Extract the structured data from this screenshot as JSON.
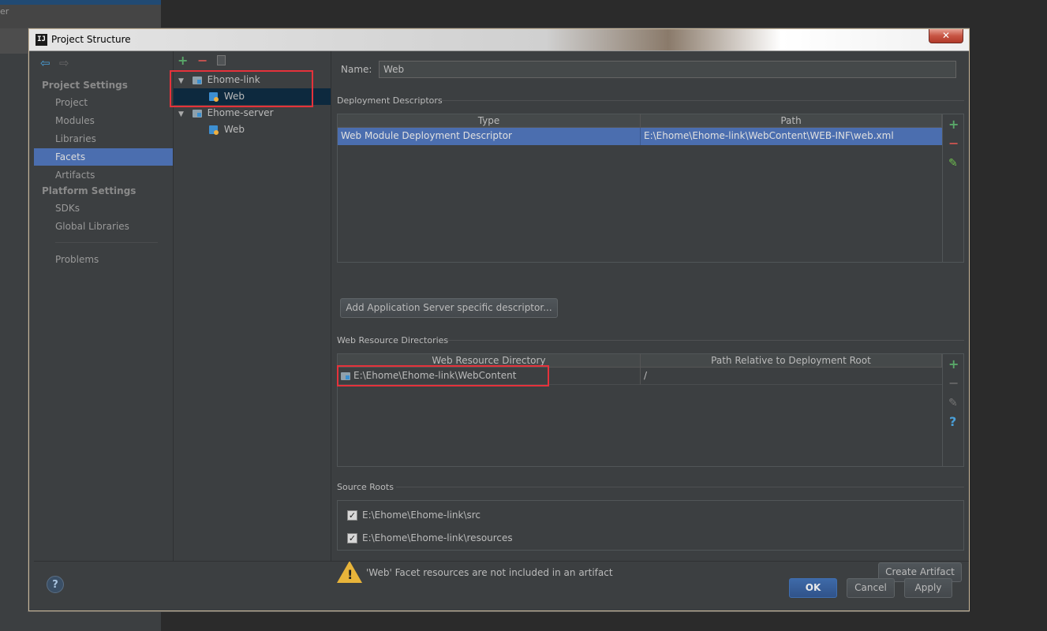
{
  "background": {
    "left_panel_text": "er"
  },
  "window": {
    "icon_text": "IJ",
    "title": "Project Structure",
    "close_glyph": "✕"
  },
  "nav": {
    "back_glyph": "⇦",
    "forward_glyph": "⇨",
    "project_settings_heading": "Project Settings",
    "project_items": [
      "Project",
      "Modules",
      "Libraries",
      "Facets",
      "Artifacts"
    ],
    "platform_settings_heading": "Platform Settings",
    "platform_items": [
      "SDKs",
      "Global Libraries"
    ],
    "problems": "Problems",
    "selected": "Facets"
  },
  "tree": {
    "add_glyph": "+",
    "remove_glyph": "−",
    "nodes": [
      {
        "label": "Ehome-link",
        "expanded_glyph": "▼",
        "children": [
          {
            "label": "Web",
            "selected": true
          }
        ]
      },
      {
        "label": "Ehome-server",
        "expanded_glyph": "▼",
        "children": [
          {
            "label": "Web",
            "selected": false
          }
        ]
      }
    ]
  },
  "facet": {
    "name_label": "Name:",
    "name_value": "Web",
    "deployment": {
      "section_label": "Deployment Descriptors",
      "columns": [
        "Type",
        "Path"
      ],
      "rows": [
        {
          "type": "Web Module Deployment Descriptor",
          "path": "E:\\Ehome\\Ehome-link\\WebContent\\WEB-INF\\web.xml",
          "selected": true
        }
      ],
      "add_button": "Add Application Server specific descriptor..."
    },
    "resources": {
      "section_label": "Web Resource Directories",
      "columns": [
        "Web Resource Directory",
        "Path Relative to Deployment Root"
      ],
      "rows": [
        {
          "directory": "E:\\Ehome\\Ehome-link\\WebContent",
          "relative": "/"
        }
      ]
    },
    "source_roots": {
      "section_label": "Source Roots",
      "items": [
        {
          "path": "E:\\Ehome\\Ehome-link\\src",
          "checked": true
        },
        {
          "path": "E:\\Ehome\\Ehome-link\\resources",
          "checked": true
        }
      ]
    },
    "warning": {
      "text": "'Web' Facet resources are not included in an artifact",
      "button": "Create Artifact"
    },
    "tool_glyphs": {
      "add": "+",
      "remove": "−",
      "edit": "✎",
      "help": "?"
    }
  },
  "footer": {
    "help_glyph": "?",
    "ok": "OK",
    "cancel": "Cancel",
    "apply": "Apply"
  },
  "colors": {
    "accent_selection": "#4b6eaf",
    "add_green": "#59a869",
    "remove_red": "#c75450",
    "highlight_box": "#e5323b",
    "warning_yellow": "#e8b43a"
  }
}
